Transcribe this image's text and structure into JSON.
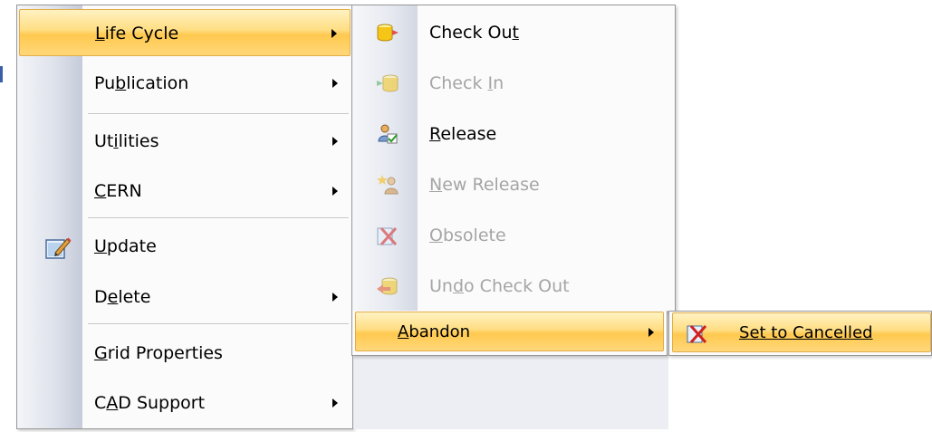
{
  "menus": {
    "main": [
      {
        "pre": "",
        "key": "L",
        "post": "ife Cycle",
        "submenu": true,
        "highlighted": true
      },
      {
        "pre": "Pu",
        "key": "b",
        "post": "lication",
        "submenu": true
      },
      {
        "pre": "Ut",
        "key": "i",
        "post": "lities",
        "submenu": true
      },
      {
        "pre": "",
        "key": "C",
        "post": "ERN",
        "submenu": true
      },
      {
        "pre": "",
        "key": "U",
        "post": "pdate",
        "submenu": false,
        "icon": "edit-document-icon"
      },
      {
        "pre": "D",
        "key": "e",
        "post": "lete",
        "submenu": true
      },
      {
        "pre": "",
        "key": "G",
        "post": "rid Properties",
        "submenu": false
      },
      {
        "pre": "C",
        "key": "A",
        "post": "D Support",
        "submenu": true
      }
    ],
    "lifecycle": [
      {
        "pre": "Check Ou",
        "key": "t",
        "post": "",
        "disabled": false,
        "icon": "check-out-icon"
      },
      {
        "pre": "Check ",
        "key": "I",
        "post": "n",
        "disabled": true,
        "icon": "check-in-icon"
      },
      {
        "pre": "",
        "key": "R",
        "post": "elease",
        "disabled": false,
        "icon": "release-icon"
      },
      {
        "pre": "",
        "key": "N",
        "post": "ew Release",
        "disabled": true,
        "icon": "new-release-icon"
      },
      {
        "pre": "",
        "key": "O",
        "post": "bsolete",
        "disabled": true,
        "icon": "obsolete-icon"
      },
      {
        "pre": "Un",
        "key": "d",
        "post": "o Check Out",
        "disabled": true,
        "icon": "undo-check-out-icon"
      },
      {
        "pre": "",
        "key": "A",
        "post": "bandon",
        "disabled": false,
        "submenu": true,
        "highlighted": true
      }
    ],
    "abandon": [
      {
        "pre": "",
        "key": "S",
        "post": "et to Cancelled",
        "disabled": false,
        "icon": "cancel-icon",
        "highlighted": true
      }
    ]
  }
}
